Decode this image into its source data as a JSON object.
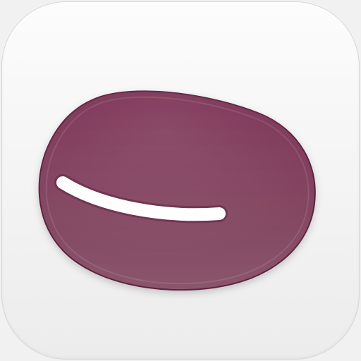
{
  "app": {
    "icon_name": "bean-icon",
    "colors": {
      "background_top": "#fcfcfc",
      "background_bottom": "#ececec",
      "icon_border": "#d6d6d6",
      "bean_top": "#7a2f52",
      "bean_bottom": "#8a566c",
      "bean_edge": "#5e2440",
      "highlight": "#ffffff"
    }
  }
}
